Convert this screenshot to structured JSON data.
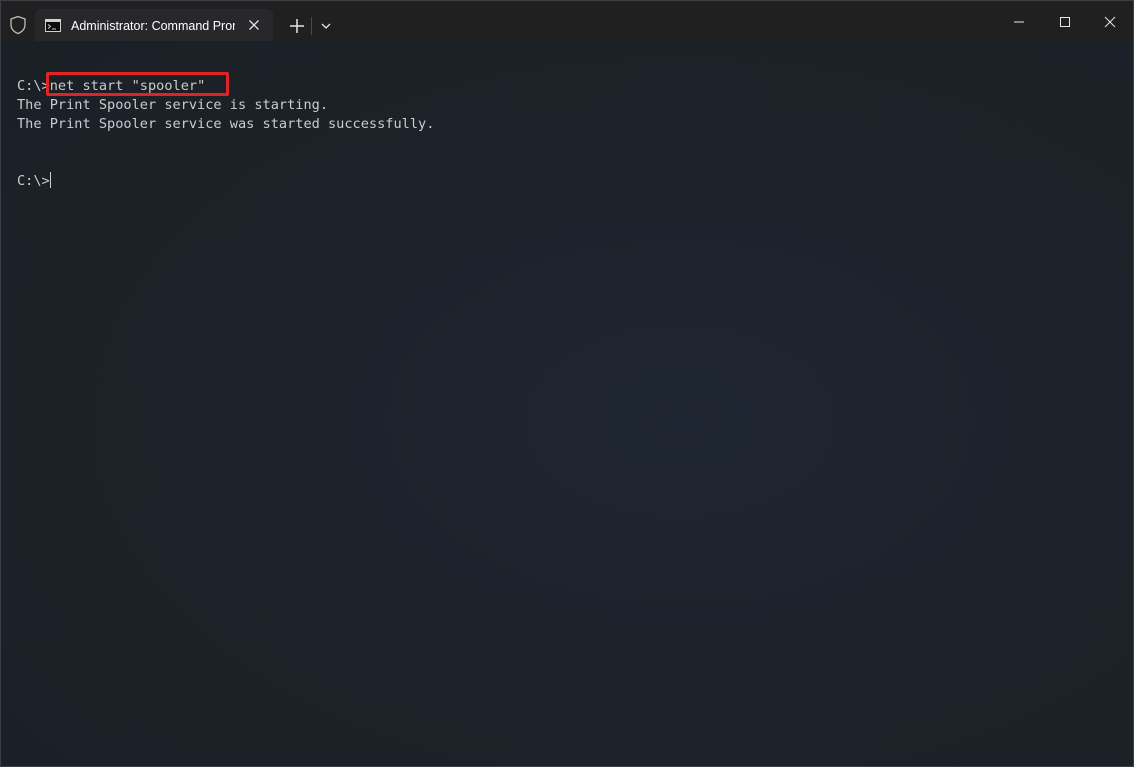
{
  "tab": {
    "title": "Administrator: Command Prompt",
    "icon": "cmd-icon"
  },
  "titlebar": {
    "security_icon": "shield-icon",
    "new_tab_icon": "plus-icon",
    "dropdown_icon": "chevron-down-icon",
    "minimize_icon": "minimize-icon",
    "maximize_icon": "maximize-icon",
    "close_icon": "close-icon"
  },
  "terminal": {
    "prompt": "C:\\>",
    "command": "net start \"spooler\"",
    "output": [
      "The Print Spooler service is starting.",
      "The Print Spooler service was started successfully."
    ],
    "final_prompt": "C:\\>"
  },
  "colors": {
    "titlebar": "#202020",
    "tab": "#28282b",
    "terminal_bg": "#1c2229",
    "text": "#cccccc",
    "highlight": "#e02424"
  }
}
